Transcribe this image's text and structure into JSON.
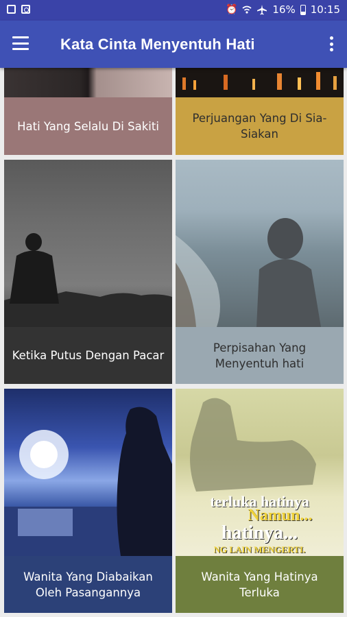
{
  "status_bar": {
    "battery": "16%",
    "time": "10:15"
  },
  "app_bar": {
    "title": "Kata Cinta Menyentuh Hati"
  },
  "cards": [
    {
      "caption": "Hati Yang Selalu Di Sakiti",
      "caption_bg": "#9a7777",
      "caption_color": "#ffffff"
    },
    {
      "caption": "Perjuangan Yang Di Sia-Siakan",
      "caption_bg": "#c9a243",
      "caption_color": "#2e2e2e"
    },
    {
      "caption": "Ketika Putus Dengan Pacar",
      "caption_bg": "#333333",
      "caption_color": "#ffffff"
    },
    {
      "caption": "Perpisahan Yang Menyentuh hati",
      "caption_bg": "#9aa8b1",
      "caption_color": "#2e2e2e"
    },
    {
      "caption": "Wanita Yang Diabaikan Oleh Pasangannya",
      "caption_bg": "#2c4178",
      "caption_color": "#ffffff"
    },
    {
      "caption": "Wanita Yang Hatinya Terluka",
      "caption_bg": "#6f7f3e",
      "caption_color": "#ffffff"
    }
  ],
  "image_text": {
    "line1": "terluka hatinya",
    "line2": "Namun...",
    "line3": "hatinya...",
    "line4": "NG LAIN MENGERTI."
  }
}
